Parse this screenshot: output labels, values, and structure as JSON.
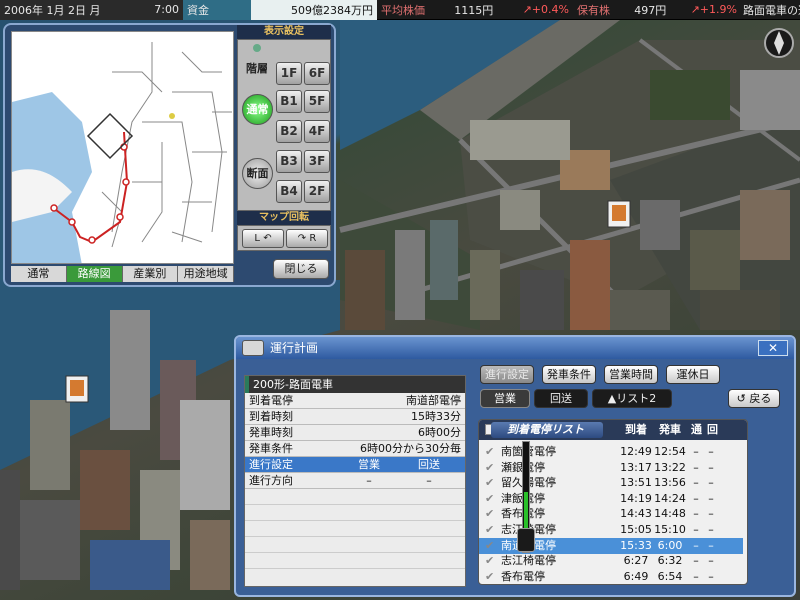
{
  "topbar": {
    "date": "2006年 1月 2日 月",
    "time": "7:00",
    "funds_label": "資金",
    "funds_value": "509億2384万円",
    "avg_stock_label": "平均株価",
    "avg_stock_value": "1115円",
    "avg_stock_change": "↗+0.4%",
    "holding_label": "保有株",
    "holding_value": "497円",
    "holding_change": "↗+1.9%",
    "ticker": "路面電車の運行計"
  },
  "map_panel": {
    "display_settings": "表示設定",
    "floor_label": "階層",
    "mode_normal": "通常",
    "mode_section": "断面",
    "floors": [
      "1F",
      "6F",
      "B1",
      "5F",
      "B2",
      "4F",
      "B3",
      "3F",
      "B4",
      "2F"
    ],
    "rotation_label": "マップ回転",
    "rotate_left": "L",
    "rotate_right": "R",
    "close": "閉じる",
    "tabs": [
      {
        "label": "通常",
        "active": false
      },
      {
        "label": "路線図",
        "active": true
      },
      {
        "label": "産業別",
        "active": false
      },
      {
        "label": "用途地域",
        "active": false
      }
    ]
  },
  "dialog": {
    "title": "運行計画",
    "close": "✕",
    "vehicle": "200形-路面電車",
    "info": [
      {
        "key": "到着電停",
        "value": "南道部電停"
      },
      {
        "key": "到着時刻",
        "value": "15時33分"
      },
      {
        "key": "発車時刻",
        "value": "6時00分"
      },
      {
        "key": "発車条件",
        "value": "6時00分から30分毎"
      }
    ],
    "progress_row": {
      "key": "進行設定",
      "c1": "営業",
      "c2": "回送"
    },
    "direction_row": {
      "key": "進行方向",
      "c1": "–",
      "c2": "–"
    },
    "buttons": {
      "progress_setting": "進行設定",
      "depart_condition": "発車条件",
      "business_hours": "営業時間",
      "holiday": "運休日",
      "service": "営業",
      "deadhead": "回送",
      "list2": "▲リスト2",
      "back": "戻る"
    },
    "list": {
      "title": "到着電停リスト",
      "col_arrive": "到着",
      "col_depart": "発車",
      "col_pass": "通",
      "col_return": "回",
      "rows": [
        {
          "name": "南箇管電停",
          "arrive": "12:49",
          "depart": "12:54",
          "p": "–",
          "r": "–",
          "selected": false
        },
        {
          "name": "瀬銀電停",
          "arrive": "13:17",
          "depart": "13:22",
          "p": "–",
          "r": "–",
          "selected": false
        },
        {
          "name": "留久場電停",
          "arrive": "13:51",
          "depart": "13:56",
          "p": "–",
          "r": "–",
          "selected": false
        },
        {
          "name": "津飯電停",
          "arrive": "14:19",
          "depart": "14:24",
          "p": "–",
          "r": "–",
          "selected": false
        },
        {
          "name": "香布電停",
          "arrive": "14:43",
          "depart": "14:48",
          "p": "–",
          "r": "–",
          "selected": false
        },
        {
          "name": "志江椅電停",
          "arrive": "15:05",
          "depart": "15:10",
          "p": "–",
          "r": "–",
          "selected": false
        },
        {
          "name": "南道部電停",
          "arrive": "15:33",
          "depart": "6:00",
          "p": "–",
          "r": "–",
          "selected": true
        },
        {
          "name": "志江椅電停",
          "arrive": "6:27",
          "depart": "6:32",
          "p": "–",
          "r": "–",
          "selected": false
        },
        {
          "name": "香布電停",
          "arrive": "6:49",
          "depart": "6:54",
          "p": "–",
          "r": "–",
          "selected": false
        }
      ]
    }
  }
}
